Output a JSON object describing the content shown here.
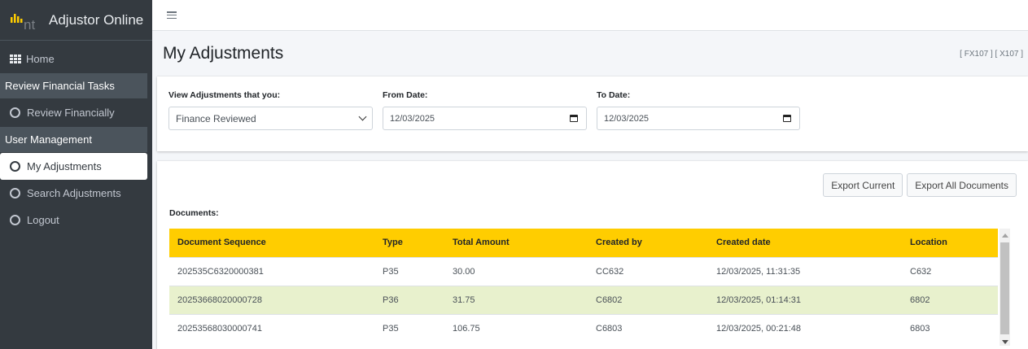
{
  "brand": {
    "name": "Adjustor Online",
    "logo_letters": "nt"
  },
  "sidebar": {
    "home": "Home",
    "section_review": "Review Financial Tasks",
    "review_financially": "Review Financially",
    "section_user": "User Management",
    "my_adjustments": "My Adjustments",
    "search_adjustments": "Search Adjustments",
    "logout": "Logout"
  },
  "header": {
    "title": "My Adjustments",
    "codes": "[ FX107 ] [ X107 ]"
  },
  "filters": {
    "view_label": "View Adjustments that you:",
    "view_selected": "Finance Reviewed",
    "from_label": "From Date:",
    "from_value": "12/03/2025",
    "to_label": "To Date:",
    "to_value": "12/03/2025"
  },
  "documents": {
    "export_current": "Export Current",
    "export_all": "Export All Documents",
    "label": "Documents:",
    "columns": [
      "Document Sequence",
      "Type",
      "Total Amount",
      "Created by",
      "Created date",
      "Location"
    ],
    "rows": [
      [
        "202535C6320000381",
        "P35",
        "30.00",
        "CC632",
        "12/03/2025, 11:31:35",
        "C632"
      ],
      [
        "20253668020000728",
        "P36",
        "31.75",
        "C6802",
        "12/03/2025, 01:14:31",
        "6802"
      ],
      [
        "20253568030000741",
        "P35",
        "106.75",
        "C6803",
        "12/03/2025, 00:21:48",
        "6803"
      ]
    ]
  },
  "colors": {
    "accent": "#ffcd00",
    "sidebar": "#343a40",
    "highlight_row": "#e8f1cd"
  }
}
